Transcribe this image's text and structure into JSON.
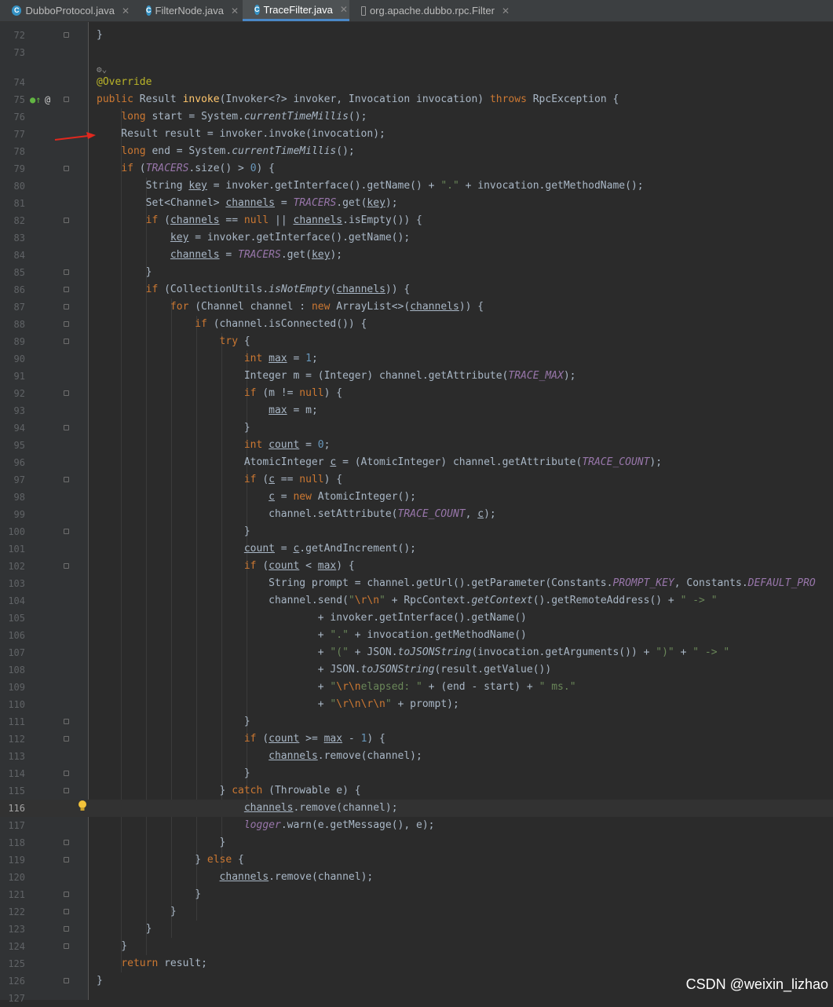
{
  "tabs": [
    {
      "label": "DubboProtocol.java",
      "icon": "java-class-icon",
      "active": false
    },
    {
      "label": "FilterNode.java",
      "icon": "java-class-icon",
      "active": false
    },
    {
      "label": "TraceFilter.java",
      "icon": "java-class-icon",
      "active": true
    },
    {
      "label": "org.apache.dubbo.rpc.Filter",
      "icon": "file-icon",
      "active": false
    }
  ],
  "editor": {
    "current_line": 116,
    "lines": [
      {
        "n": "72",
        "text": "}",
        "fold": true
      },
      {
        "n": "73",
        "text": ""
      },
      {
        "n": "74",
        "text": "@Override"
      },
      {
        "n": "75",
        "text": "public Result invoke(Invoker<?> invoker, Invocation invocation) throws RpcException {",
        "fold": true
      },
      {
        "n": "76",
        "text": "    long start = System.currentTimeMillis();"
      },
      {
        "n": "77",
        "text": "    Result result = invoker.invoke(invocation);"
      },
      {
        "n": "78",
        "text": "    long end = System.currentTimeMillis();"
      },
      {
        "n": "79",
        "text": "    if (TRACERS.size() > 0) {",
        "fold": true
      },
      {
        "n": "80",
        "text": "        String key = invoker.getInterface().getName() + \".\" + invocation.getMethodName();"
      },
      {
        "n": "81",
        "text": "        Set<Channel> channels = TRACERS.get(key);"
      },
      {
        "n": "82",
        "text": "        if (channels == null || channels.isEmpty()) {",
        "fold": true
      },
      {
        "n": "83",
        "text": "            key = invoker.getInterface().getName();"
      },
      {
        "n": "84",
        "text": "            channels = TRACERS.get(key);"
      },
      {
        "n": "85",
        "text": "        }",
        "fold": true
      },
      {
        "n": "86",
        "text": "        if (CollectionUtils.isNotEmpty(channels)) {",
        "fold": true
      },
      {
        "n": "87",
        "text": "            for (Channel channel : new ArrayList<>(channels)) {",
        "fold": true
      },
      {
        "n": "88",
        "text": "                if (channel.isConnected()) {",
        "fold": true
      },
      {
        "n": "89",
        "text": "                    try {",
        "fold": true
      },
      {
        "n": "90",
        "text": "                        int max = 1;"
      },
      {
        "n": "91",
        "text": "                        Integer m = (Integer) channel.getAttribute(TRACE_MAX);"
      },
      {
        "n": "92",
        "text": "                        if (m != null) {",
        "fold": true
      },
      {
        "n": "93",
        "text": "                            max = m;"
      },
      {
        "n": "94",
        "text": "                        }",
        "fold": true
      },
      {
        "n": "95",
        "text": "                        int count = 0;"
      },
      {
        "n": "96",
        "text": "                        AtomicInteger c = (AtomicInteger) channel.getAttribute(TRACE_COUNT);"
      },
      {
        "n": "97",
        "text": "                        if (c == null) {",
        "fold": true
      },
      {
        "n": "98",
        "text": "                            c = new AtomicInteger();"
      },
      {
        "n": "99",
        "text": "                            channel.setAttribute(TRACE_COUNT, c);"
      },
      {
        "n": "100",
        "text": "                        }",
        "fold": true
      },
      {
        "n": "101",
        "text": "                        count = c.getAndIncrement();"
      },
      {
        "n": "102",
        "text": "                        if (count < max) {",
        "fold": true
      },
      {
        "n": "103",
        "text": "                            String prompt = channel.getUrl().getParameter(Constants.PROMPT_KEY, Constants.DEFAULT_PRO"
      },
      {
        "n": "104",
        "text": "                            channel.send(\"\\r\\n\" + RpcContext.getContext().getRemoteAddress() + \" -> \""
      },
      {
        "n": "105",
        "text": "                                    + invoker.getInterface().getName()"
      },
      {
        "n": "106",
        "text": "                                    + \".\" + invocation.getMethodName()"
      },
      {
        "n": "107",
        "text": "                                    + \"(\" + JSON.toJSONString(invocation.getArguments()) + \")\" + \" -> \""
      },
      {
        "n": "108",
        "text": "                                    + JSON.toJSONString(result.getValue())"
      },
      {
        "n": "109",
        "text": "                                    + \"\\r\\nelapsed: \" + (end - start) + \" ms.\""
      },
      {
        "n": "110",
        "text": "                                    + \"\\r\\n\\r\\n\" + prompt);"
      },
      {
        "n": "111",
        "text": "                        }",
        "fold": true
      },
      {
        "n": "112",
        "text": "                        if (count >= max - 1) {",
        "fold": true
      },
      {
        "n": "113",
        "text": "                            channels.remove(channel);"
      },
      {
        "n": "114",
        "text": "                        }",
        "fold": true
      },
      {
        "n": "115",
        "text": "                    } catch (Throwable e) {",
        "fold": true
      },
      {
        "n": "116",
        "text": "                        channels.remove(channel);"
      },
      {
        "n": "117",
        "text": "                        logger.warn(e.getMessage(), e);"
      },
      {
        "n": "118",
        "text": "                    }",
        "fold": true
      },
      {
        "n": "119",
        "text": "                } else {",
        "fold": true
      },
      {
        "n": "120",
        "text": "                    channels.remove(channel);"
      },
      {
        "n": "121",
        "text": "                }",
        "fold": true
      },
      {
        "n": "122",
        "text": "            }",
        "fold": true
      },
      {
        "n": "123",
        "text": "        }",
        "fold": true
      },
      {
        "n": "124",
        "text": "    }",
        "fold": true
      },
      {
        "n": "125",
        "text": "    return result;"
      },
      {
        "n": "126",
        "text": "}",
        "fold": true
      },
      {
        "n": "127",
        "text": ""
      }
    ]
  },
  "watermark": "CSDN @weixin_lizhao",
  "colors": {
    "background": "#2b2b2b",
    "gutter": "#313335",
    "keyword": "#cc7832",
    "string": "#6a8759",
    "number": "#6897bb",
    "constant": "#9876aa",
    "annotation": "#bbb529",
    "method_decl": "#ffc66d",
    "text": "#a9b7c6",
    "arrow": "#e0281e",
    "bulb": "#f3c33a"
  }
}
